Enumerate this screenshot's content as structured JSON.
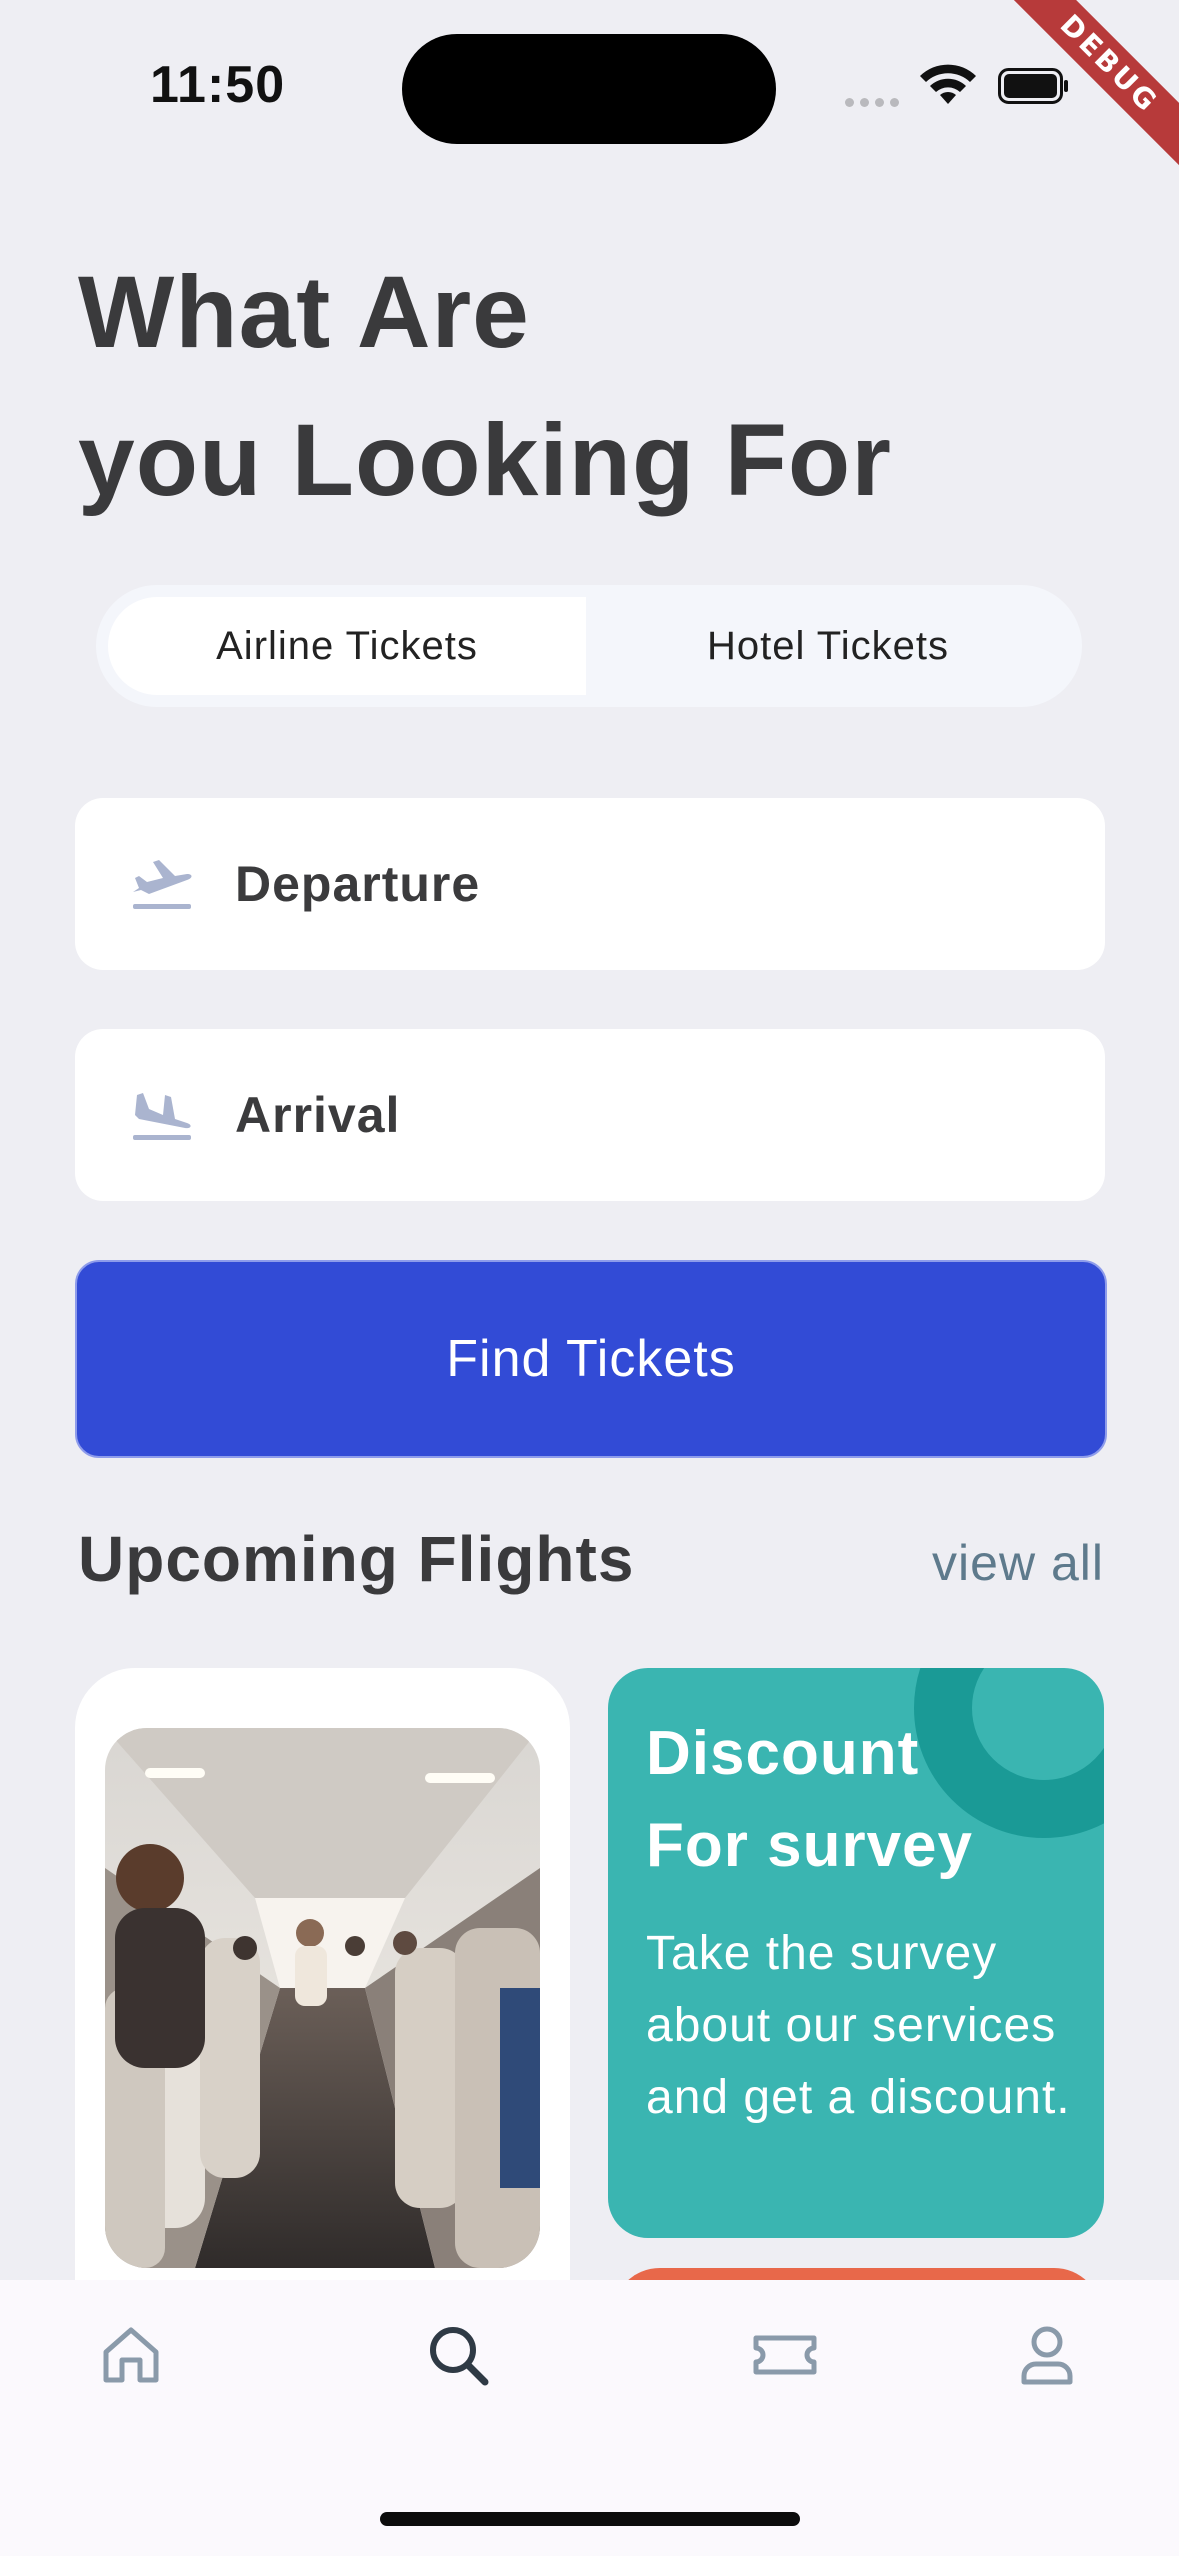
{
  "status_bar": {
    "time": "11:50"
  },
  "debug_banner": "DEBUG",
  "heading": {
    "line1": "What Are",
    "line2": "you Looking For"
  },
  "segmented": {
    "tabs": [
      {
        "label": "Airline Tickets",
        "active": true
      },
      {
        "label": "Hotel Tickets",
        "active": false
      }
    ]
  },
  "fields": {
    "departure": "Departure",
    "arrival": "Arrival"
  },
  "find_button": "Find Tickets",
  "upcoming": {
    "title": "Upcoming Flights",
    "view_all": "view all"
  },
  "promo": {
    "title_line1": "Discount",
    "title_line2": "For survey",
    "text": "Take the survey about our services and get a discount."
  },
  "tabbar": {
    "items": [
      "home-icon",
      "search-icon",
      "ticket-icon",
      "profile-icon"
    ],
    "active": "search-icon"
  },
  "colors": {
    "accent": "#324bd6",
    "promo": "#3ab5b1",
    "promo_ring": "#1a9a96",
    "orange": "#e8684a",
    "background": "#eeeef3"
  }
}
